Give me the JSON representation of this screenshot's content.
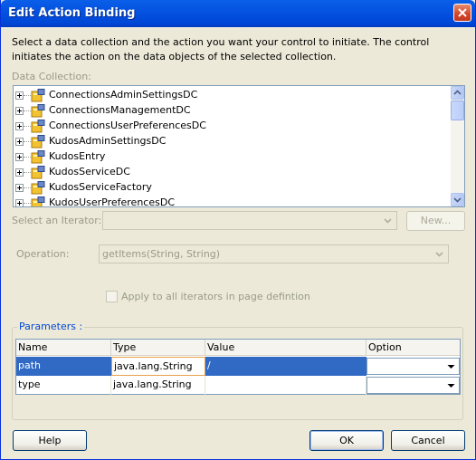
{
  "window": {
    "title": "Edit Action Binding"
  },
  "description": "Select a data collection and the action you want your control to initiate. The control initiates the action on the data objects of the selected collection.",
  "data_collection": {
    "label": "Data Collection:",
    "items": [
      "ConnectionsAdminSettingsDC",
      "ConnectionsManagementDC",
      "ConnectionsUserPreferencesDC",
      "KudosAdminSettingsDC",
      "KudosEntry",
      "KudosServiceDC",
      "KudosServiceFactory",
      "KudosUserPreferencesDC"
    ]
  },
  "iterator": {
    "label": "Select an Iterator:",
    "value": "",
    "new_button": "New..."
  },
  "operation": {
    "label": "Operation:",
    "value": "getItems(String, String)"
  },
  "apply_all": {
    "label": "Apply to all iterators in page defintion",
    "checked": false
  },
  "parameters": {
    "title": "Parameters :",
    "columns": [
      "Name",
      "Type",
      "Value",
      "Option"
    ],
    "rows": [
      {
        "name": "path",
        "type": "java.lang.String",
        "value": "/",
        "option": "",
        "selected": true
      },
      {
        "name": "type",
        "type": "java.lang.String",
        "value": "",
        "option": "",
        "selected": false
      }
    ]
  },
  "buttons": {
    "help": "Help",
    "ok": "OK",
    "cancel": "Cancel"
  },
  "colors": {
    "title_bar": "#0054e3",
    "dialog_bg": "#ece9d8",
    "selection": "#316ac5",
    "group_title": "#0046d5"
  }
}
